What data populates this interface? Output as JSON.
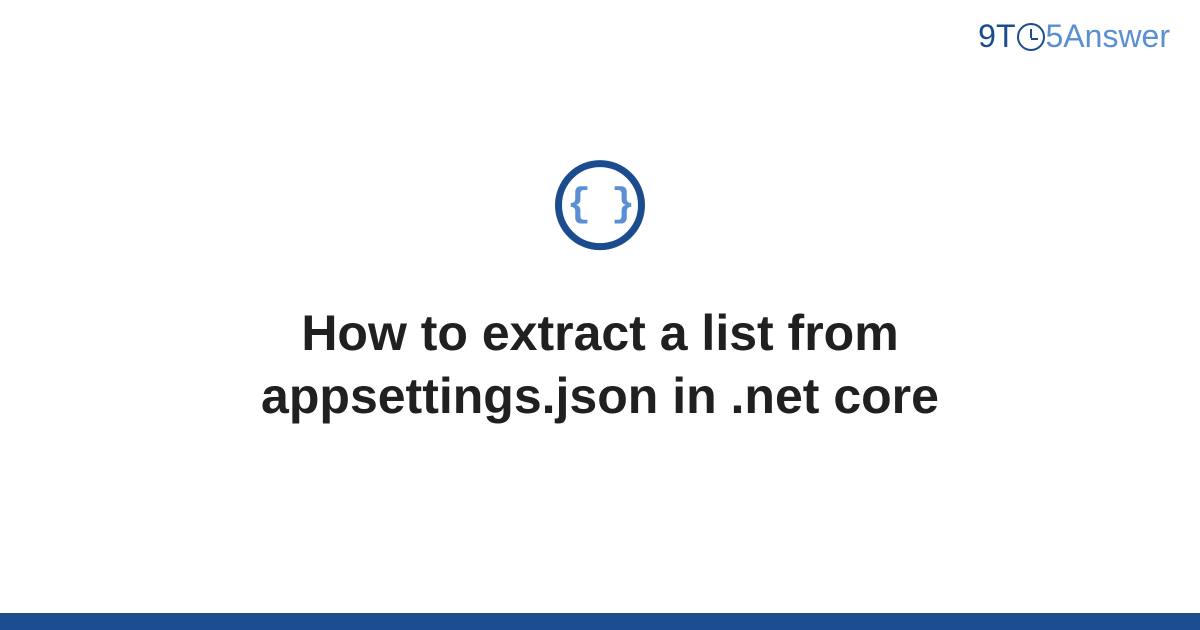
{
  "logo": {
    "part1": "9T",
    "part2": "5Answer"
  },
  "icon": {
    "braces": "{ }",
    "semantic": "json-braces-icon"
  },
  "title": "How to extract a list from appsettings.json in .net core",
  "colors": {
    "dark_blue": "#1a4c8f",
    "light_blue": "#5a8fd4",
    "text": "#202020"
  }
}
